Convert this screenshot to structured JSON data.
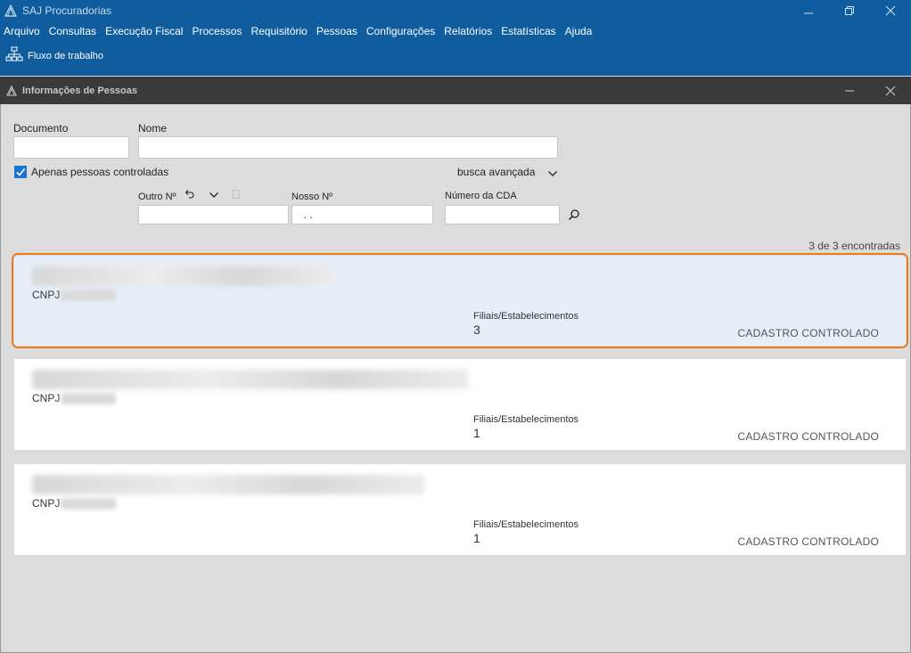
{
  "app": {
    "title": "SAJ Procuradorias"
  },
  "menu": [
    "Arquivo",
    "Consultas",
    "Execução Fiscal",
    "Processos",
    "Requisitório",
    "Pessoas",
    "Configurações",
    "Relatórios",
    "Estatísticas",
    "Ajuda"
  ],
  "toolbar": {
    "workflow_label": "Fluxo de trabalho"
  },
  "window": {
    "title": "Informações de Pessoas"
  },
  "form": {
    "documento_label": "Documento",
    "documento_value": "",
    "nome_label": "Nome",
    "nome_value": "",
    "apenas_label": "Apenas pessoas controladas",
    "apenas_checked": true,
    "busca_avancada_label": "busca avançada",
    "outro_label": "Outro Nº",
    "outro_value": "",
    "nosso_label": "Nosso Nº",
    "nosso_value": "  . .",
    "cda_label": "Número da CDA",
    "cda_value": ""
  },
  "results": {
    "count_text": "3 de 3 encontradas",
    "cnpj_label": "CNPJ",
    "filiais_label": "Filiais/Estabelecimentos",
    "items": [
      {
        "filiais": "3",
        "status": "CADASTRO CONTROLADO",
        "selected": true
      },
      {
        "filiais": "1",
        "status": "CADASTRO CONTROLADO",
        "selected": false
      },
      {
        "filiais": "1",
        "status": "CADASTRO CONTROLADO",
        "selected": false
      }
    ]
  },
  "colors": {
    "brand_blue": "#0f5d9e",
    "selection_orange": "#e87d1e",
    "inner_titlebar": "#3a3a3a"
  }
}
